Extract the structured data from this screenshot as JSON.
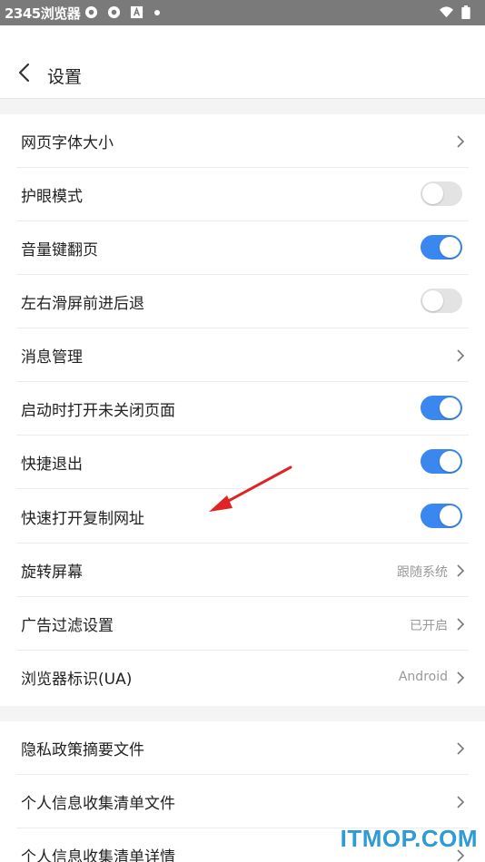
{
  "status_bar": {
    "time": "2345浏览器",
    "icons": [
      "sync-icon",
      "sync-icon",
      "text-icon",
      "dot-icon",
      "wifi-icon",
      "battery-icon"
    ]
  },
  "header": {
    "back_icon": "chevron-left-icon",
    "title": "设置"
  },
  "section1": {
    "items": [
      {
        "label": "网页字体大小",
        "control": "chevron"
      },
      {
        "label": "护眼模式",
        "control": "toggle",
        "state": "off"
      },
      {
        "label": "音量键翻页",
        "control": "toggle",
        "state": "on"
      },
      {
        "label": "左右滑屏前进后退",
        "control": "toggle",
        "state": "off"
      },
      {
        "label": "消息管理",
        "control": "chevron"
      },
      {
        "label": "启动时打开未关闭页面",
        "control": "toggle",
        "state": "on"
      },
      {
        "label": "快捷退出",
        "control": "toggle",
        "state": "on"
      },
      {
        "label": "快速打开复制网址",
        "control": "toggle",
        "state": "on"
      },
      {
        "label": "旋转屏幕",
        "control": "chevron",
        "value": "跟随系统"
      },
      {
        "label": "广告过滤设置",
        "control": "chevron",
        "value": "已开启"
      },
      {
        "label": "浏览器标识(UA)",
        "control": "chevron",
        "value": "Android"
      }
    ]
  },
  "section2": {
    "items": [
      {
        "label": "隐私政策摘要文件",
        "control": "chevron"
      },
      {
        "label": "个人信息收集清单文件",
        "control": "chevron"
      },
      {
        "label": "个人信息收集清单详情",
        "control": "chevron"
      }
    ]
  },
  "colors": {
    "accent": "#3a87ef",
    "annotation_arrow": "#e02424",
    "watermark": "#2e9bd6"
  },
  "watermark": "ITMOP.COM"
}
